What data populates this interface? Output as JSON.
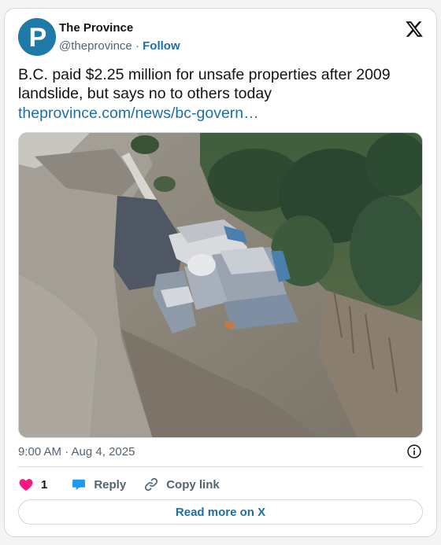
{
  "author": {
    "name": "The Province",
    "handle": "@theprovince",
    "separator": "·",
    "follow_label": "Follow",
    "avatar_letter": "P"
  },
  "tweet": {
    "text": "B.C. paid $2.25 million for unsafe properties after 2009 landslide, but says no to others today",
    "link": "theprovince.com/news/bc-govern…",
    "timestamp": "9:00 AM · Aug 4, 2025"
  },
  "actions": {
    "like_count": "1",
    "reply_label": "Reply",
    "copy_label": "Copy link",
    "read_more_label": "Read more on X"
  },
  "colors": {
    "brand_blue": "#1d6fa5",
    "like_pink": "#f91880",
    "avatar_bg": "#1f7aa8"
  },
  "icons": {
    "platform": "x-logo-icon",
    "info": "info-icon",
    "like": "heart-icon",
    "reply": "speech-bubble-icon",
    "copy": "link-icon"
  }
}
